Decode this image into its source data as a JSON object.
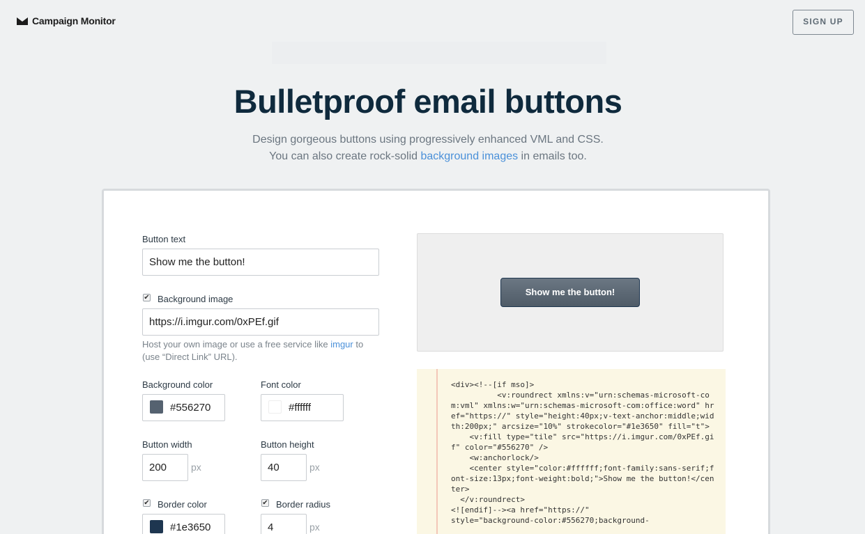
{
  "header": {
    "logo_text": "Campaign Monitor",
    "signup_label": "SIGN UP"
  },
  "hero": {
    "title": "Bulletproof email buttons",
    "subtitle_line1": "Design gorgeous buttons using progressively enhanced VML and CSS.",
    "subtitle_line2_pre": "You can also create rock-solid ",
    "subtitle_link": "background images",
    "subtitle_line2_post": " in emails too."
  },
  "form": {
    "button_text_label": "Button text",
    "button_text_value": "Show me the button!",
    "bg_image_checked": true,
    "bg_image_label": "Background image",
    "bg_image_value": "https://i.imgur.com/0xPEf.gif",
    "help_pre": "Host your own image or use a free service like ",
    "help_link": "imgur",
    "help_post": " to",
    "help_line2": "(use “Direct Link” URL).",
    "bg_color_label": "Background color",
    "bg_color_value": "#556270",
    "font_color_label": "Font color",
    "font_color_value": "#ffffff",
    "font_color_display": "#ffffff",
    "width_label": "Button width",
    "width_value": "200",
    "height_label": "Button height",
    "height_value": "40",
    "unit": "px",
    "border_color_checked": true,
    "border_color_label": "Border color",
    "border_color_value": "#1e3650",
    "border_radius_checked": true,
    "border_radius_label": "Border radius",
    "border_radius_value": "4"
  },
  "preview": {
    "button_label": "Show me the button!"
  },
  "code": {
    "text": "<div><!--[if mso]>\n          <v:roundrect xmlns:v=\"urn:schemas-microsoft-com:vml\" xmlns:w=\"urn:schemas-microsoft-com:office:word\" href=\"https://\" style=\"height:40px;v-text-anchor:middle;width:200px;\" arcsize=\"10%\" strokecolor=\"#1e3650\" fill=\"t\">\n    <v:fill type=\"tile\" src=\"https://i.imgur.com/0xPEf.gif\" color=\"#556270\" />\n    <w:anchorlock/>\n    <center style=\"color:#ffffff;font-family:sans-serif;font-size:13px;font-weight:bold;\">Show me the button!</center>\n  </v:roundrect>\n<![endif]--><a href=\"https://\"\nstyle=\"background-color:#556270;background-"
  }
}
